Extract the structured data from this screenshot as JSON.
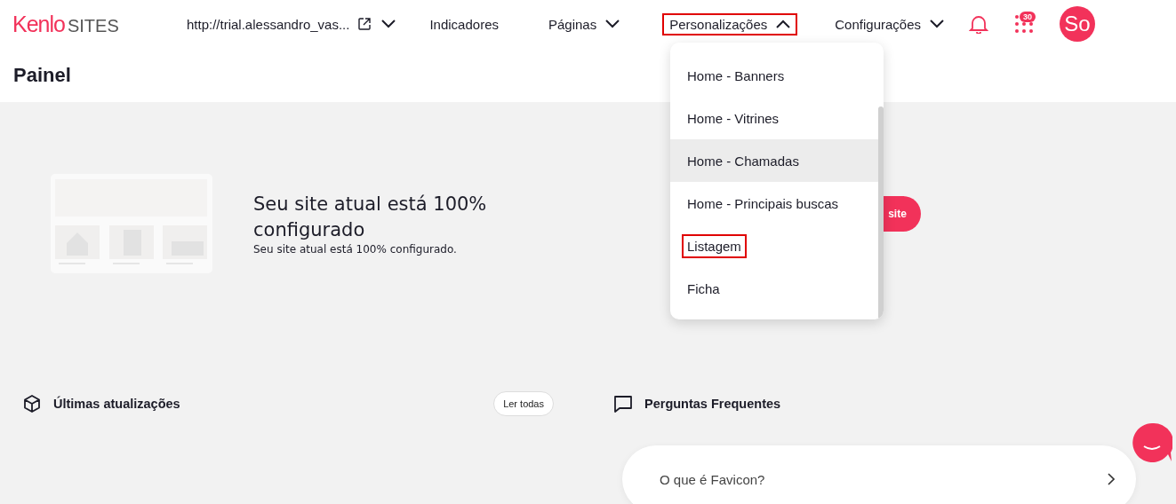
{
  "header": {
    "logo": {
      "brand": "Kenlo",
      "product": "SITES"
    },
    "site_url": "http://trial.alessandro_vas...",
    "nav": [
      {
        "label": "Indicadores",
        "kind": "link",
        "expanded": false,
        "marked": false
      },
      {
        "label": "Páginas",
        "kind": "menu",
        "expanded": false,
        "marked": false
      },
      {
        "label": "Personalizações",
        "kind": "menu",
        "expanded": true,
        "marked": true
      },
      {
        "label": "Configurações",
        "kind": "menu",
        "expanded": false,
        "marked": false
      }
    ],
    "notifications": {
      "count": "30"
    },
    "avatar": "So"
  },
  "dropdown": {
    "items": [
      {
        "label": "Home - Banners",
        "hovered": false,
        "marked": false
      },
      {
        "label": "Home - Vitrines",
        "hovered": false,
        "marked": false
      },
      {
        "label": "Home - Chamadas",
        "hovered": true,
        "marked": false
      },
      {
        "label": "Home - Principais buscas",
        "hovered": false,
        "marked": false
      },
      {
        "label": "Listagem",
        "hovered": false,
        "marked": true
      },
      {
        "label": "Ficha",
        "hovered": false,
        "marked": false
      }
    ]
  },
  "page_title": "Painel",
  "hero": {
    "title": "Seu site atual está 100% configurado",
    "subtitle": "Seu site atual está 100% configurado.",
    "button": "site"
  },
  "updates": {
    "title": "Últimas atualizações",
    "button": "Ler todas"
  },
  "faq": {
    "title": "Perguntas Frequentes",
    "items": [
      {
        "question": "O que é Favicon?"
      }
    ]
  }
}
